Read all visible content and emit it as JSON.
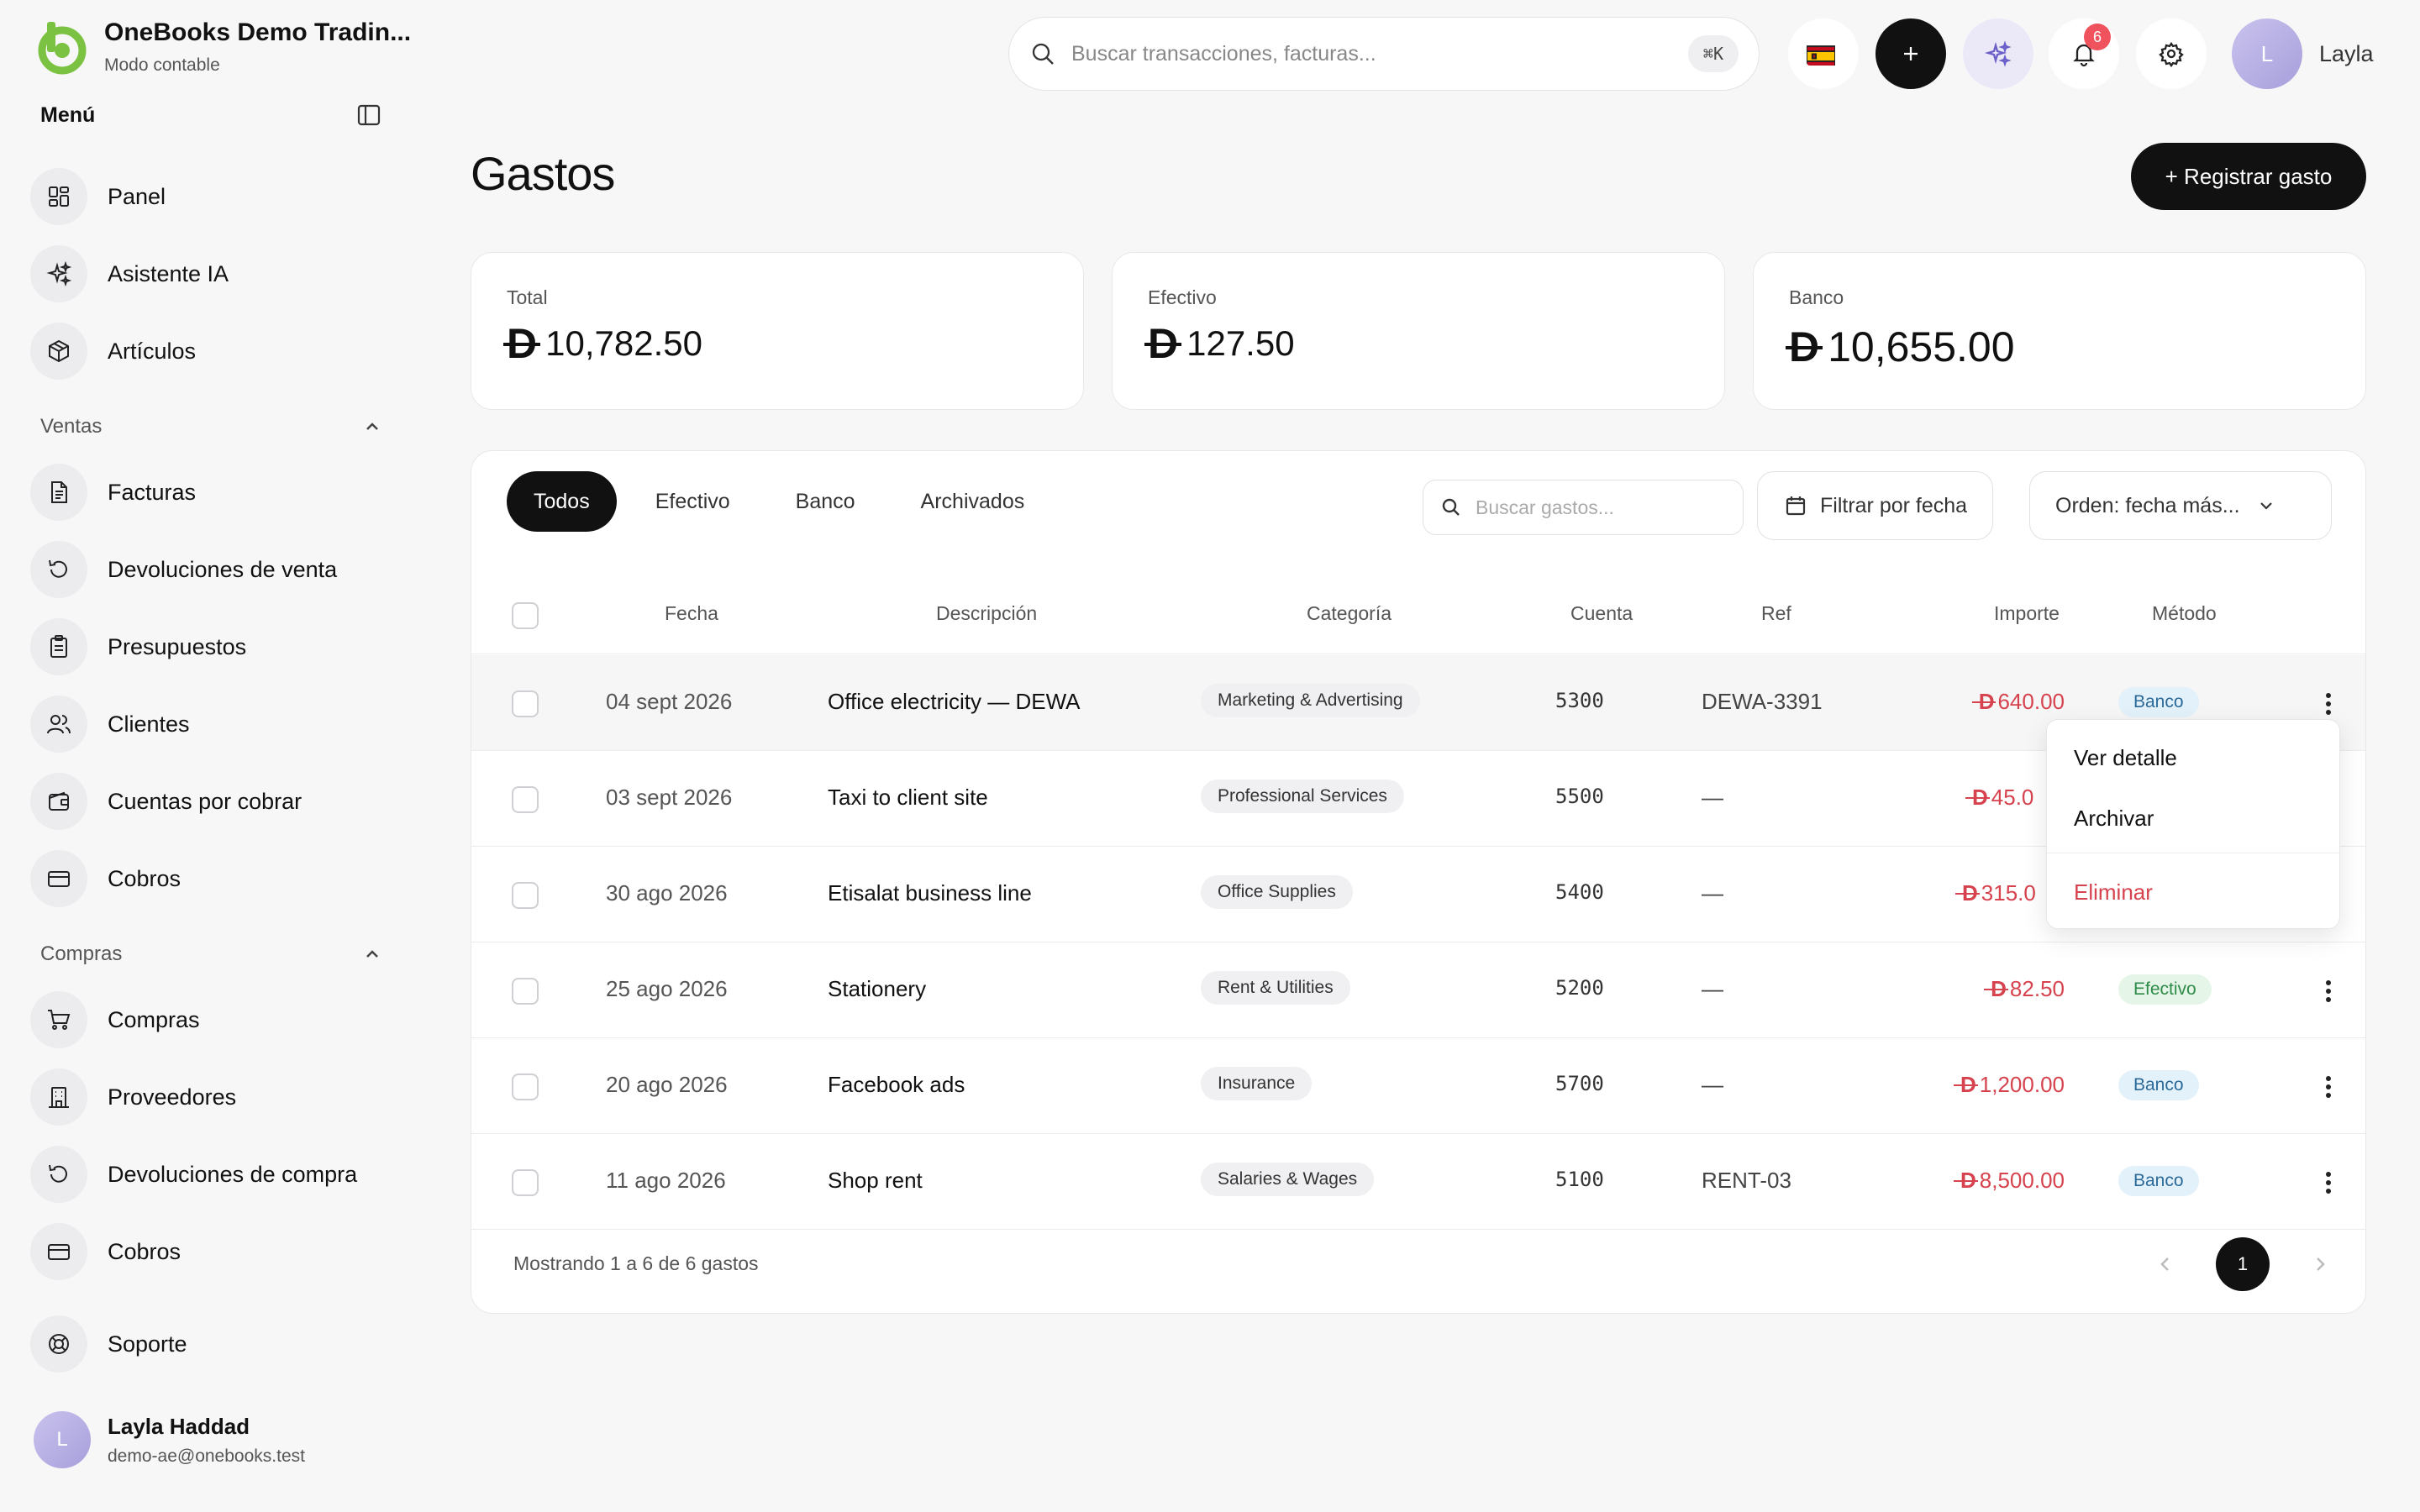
{
  "brand": {
    "name": "OneBooks Demo Tradin...",
    "mode": "Modo contable"
  },
  "sidebar": {
    "menu_title": "Menú",
    "top_items": [
      {
        "label": "Panel",
        "icon": "dashboard-icon"
      },
      {
        "label": "Asistente IA",
        "icon": "sparkles-icon"
      },
      {
        "label": "Artículos",
        "icon": "box-icon"
      }
    ],
    "sections": [
      {
        "label": "Ventas",
        "items": [
          {
            "label": "Facturas",
            "icon": "invoice-icon"
          },
          {
            "label": "Devoluciones de venta",
            "icon": "return-icon"
          },
          {
            "label": "Presupuestos",
            "icon": "clipboard-icon"
          },
          {
            "label": "Clientes",
            "icon": "users-icon"
          },
          {
            "label": "Cuentas por cobrar",
            "icon": "wallet-icon"
          },
          {
            "label": "Cobros",
            "icon": "card-icon"
          }
        ]
      },
      {
        "label": "Compras",
        "items": [
          {
            "label": "Compras",
            "icon": "cart-icon"
          },
          {
            "label": "Proveedores",
            "icon": "building-icon"
          },
          {
            "label": "Devoluciones de compra",
            "icon": "return-icon"
          },
          {
            "label": "Cobros",
            "icon": "card-icon"
          }
        ]
      }
    ],
    "support": {
      "label": "Soporte",
      "icon": "lifebuoy-icon"
    },
    "user": {
      "initial": "L",
      "name": "Layla Haddad",
      "email": "demo-ae@onebooks.test"
    }
  },
  "topbar": {
    "search_placeholder": "Buscar transacciones, facturas...",
    "shortcut": "⌘K",
    "notifications_count": "6",
    "user_initial": "L",
    "user_name": "Layla"
  },
  "page": {
    "title": "Gastos",
    "primary_action": "+ Registrar gasto"
  },
  "stats": [
    {
      "label": "Total",
      "value": "10,782.50"
    },
    {
      "label": "Efectivo",
      "value": "127.50"
    },
    {
      "label": "Banco",
      "value": "10,655.00"
    }
  ],
  "currency_symbol": "D",
  "tabs": [
    "Todos",
    "Efectivo",
    "Banco",
    "Archivados"
  ],
  "filters": {
    "search_placeholder": "Buscar gastos...",
    "date_filter": "Filtrar por fecha",
    "sort": "Orden: fecha más..."
  },
  "table": {
    "headers": {
      "fecha": "Fecha",
      "descripcion": "Descripción",
      "categoria": "Categoría",
      "cuenta": "Cuenta",
      "ref": "Ref",
      "importe": "Importe",
      "metodo": "Método"
    },
    "rows": [
      {
        "fecha": "04 sept 2026",
        "descripcion": "Office electricity — DEWA",
        "categoria": "Marketing & Advertising",
        "cuenta": "5300",
        "ref": "DEWA-3391",
        "importe": "640.00",
        "metodo": "Banco"
      },
      {
        "fecha": "03 sept 2026",
        "descripcion": "Taxi to client site",
        "categoria": "Professional Services",
        "cuenta": "5500",
        "ref": "—",
        "importe": "45.0",
        "metodo": ""
      },
      {
        "fecha": "30 ago 2026",
        "descripcion": "Etisalat business line",
        "categoria": "Office Supplies",
        "cuenta": "5400",
        "ref": "—",
        "importe": "315.0",
        "metodo": ""
      },
      {
        "fecha": "25 ago 2026",
        "descripcion": "Stationery",
        "categoria": "Rent & Utilities",
        "cuenta": "5200",
        "ref": "—",
        "importe": "82.50",
        "metodo": "Efectivo"
      },
      {
        "fecha": "20 ago 2026",
        "descripcion": "Facebook ads",
        "categoria": "Insurance",
        "cuenta": "5700",
        "ref": "—",
        "importe": "1,200.00",
        "metodo": "Banco"
      },
      {
        "fecha": "11 ago 2026",
        "descripcion": "Shop rent",
        "categoria": "Salaries & Wages",
        "cuenta": "5100",
        "ref": "RENT-03",
        "importe": "8,500.00",
        "metodo": "Banco"
      }
    ]
  },
  "row_menu": {
    "view": "Ver detalle",
    "archive": "Archivar",
    "delete": "Eliminar"
  },
  "footer": {
    "summary": "Mostrando 1 a 6 de 6 gastos",
    "current_page": "1"
  },
  "colors": {
    "accent": "#111111",
    "danger": "#d6424d",
    "brand_green": "#7cc242"
  }
}
